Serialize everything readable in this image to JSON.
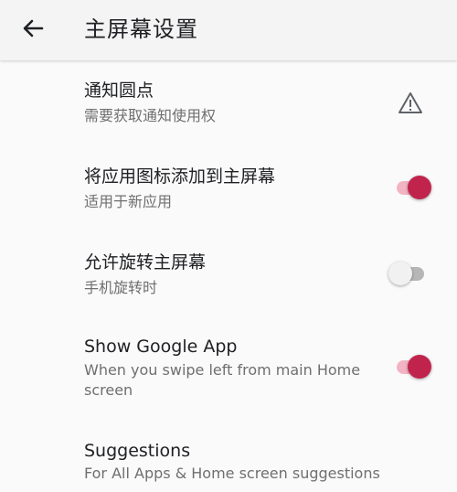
{
  "header": {
    "title": "主屏幕设置",
    "back_icon": "arrow-back-icon"
  },
  "settings": [
    {
      "title": "通知圆点",
      "subtitle": "需要获取通知使用权",
      "control": "warning-icon"
    },
    {
      "title": "将应用图标添加到主屏幕",
      "subtitle": "适用于新应用",
      "control": "toggle",
      "checked": true
    },
    {
      "title": "允许旋转主屏幕",
      "subtitle": "手机旋转时",
      "control": "toggle",
      "checked": false
    },
    {
      "title": "Show Google App",
      "subtitle": "When you swipe left from main Home screen",
      "control": "toggle",
      "checked": true
    },
    {
      "title": "Suggestions",
      "subtitle": "For All Apps & Home screen suggestions"
    }
  ],
  "colors": {
    "accent": "#c0244c",
    "accent_track": "#f2b4c3",
    "off_track": "#b6b6b6"
  }
}
